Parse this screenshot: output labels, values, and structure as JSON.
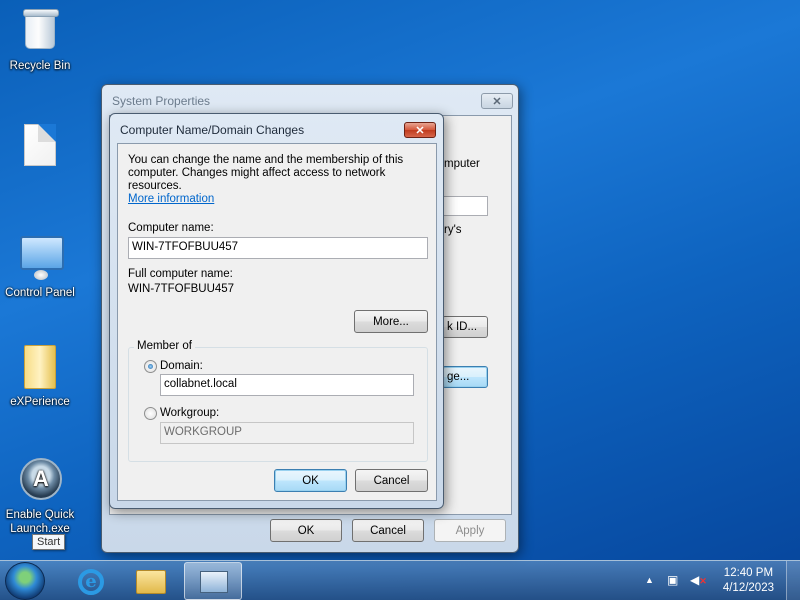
{
  "desktop": {
    "icons": [
      {
        "label": "Recycle Bin"
      },
      {
        "label": ""
      },
      {
        "label": "Control Panel"
      },
      {
        "label": "eXPerience"
      },
      {
        "label": "Enable Quick Launch.exe"
      }
    ],
    "tooltip": "Start"
  },
  "system_properties": {
    "title": "System Properties",
    "close_label": "✕",
    "partial_texts": [
      "mputer",
      "ry's",
      "k ID...",
      "ge..."
    ],
    "ok_label": "OK",
    "cancel_label": "Cancel",
    "apply_label": "Apply"
  },
  "dialog": {
    "title": "Computer Name/Domain Changes",
    "close_label": "✕",
    "description": "You can change the name and the membership of this computer. Changes might affect access to network resources.",
    "more_info_link": "More information",
    "computer_name_label": "Computer name:",
    "computer_name_value": "WIN-7TFOFBUU457",
    "full_name_label": "Full computer name:",
    "full_name_value": "WIN-7TFOFBUU457",
    "more_button": "More...",
    "member_of_label": "Member of",
    "domain_label": "Domain:",
    "domain_value": "collabnet.local",
    "workgroup_label": "Workgroup:",
    "workgroup_value": "WORKGROUP",
    "selected_membership": "Domain",
    "ok_label": "OK",
    "cancel_label": "Cancel"
  },
  "taskbar": {
    "items": [
      "internet-explorer",
      "windows-explorer",
      "system-properties"
    ],
    "active_item": "system-properties",
    "time": "12:40 PM",
    "date": "4/12/2023",
    "tray_arrow": "▲"
  }
}
